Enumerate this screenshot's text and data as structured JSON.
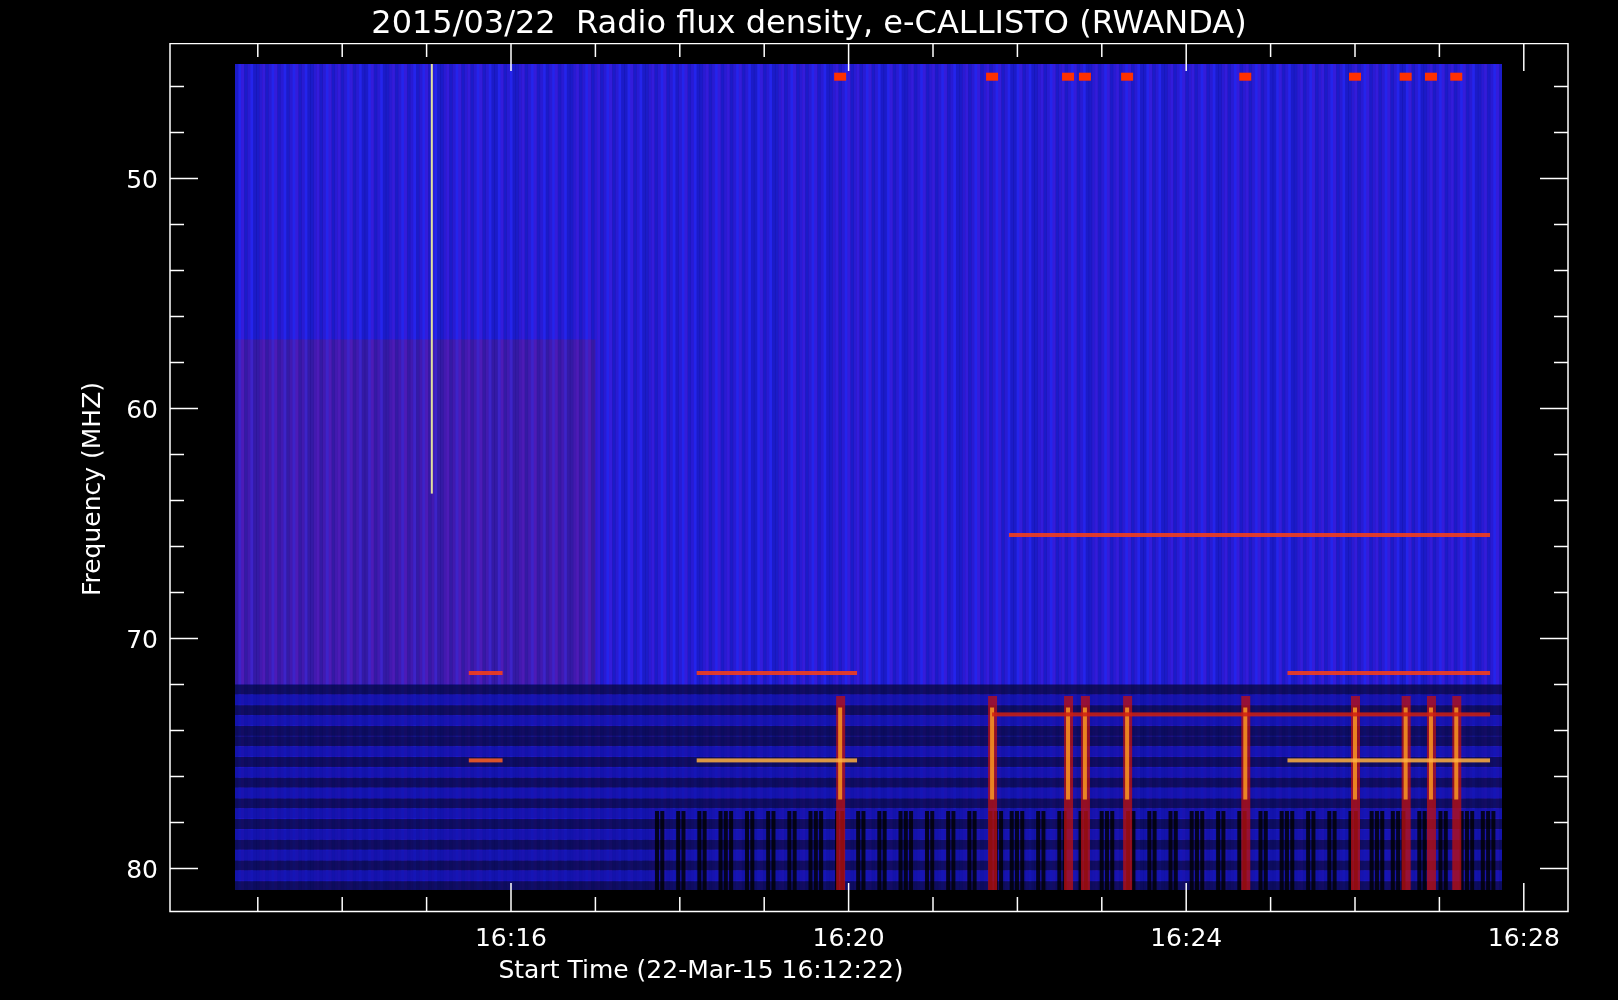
{
  "title": "2015/03/22  Radio flux density, e-CALLISTO (RWANDA)",
  "plot": {
    "ylabel": "Frequency (MHZ)",
    "xlabel": "Start Time (22-Mar-15 16:12:22)",
    "yticks": [
      {
        "label": "50"
      },
      {
        "label": "60"
      },
      {
        "label": "70"
      },
      {
        "label": "80"
      }
    ],
    "xticks": [
      {
        "label": "16:16"
      },
      {
        "label": "16:20"
      },
      {
        "label": "16:24"
      },
      {
        "label": "16:28"
      }
    ]
  }
}
